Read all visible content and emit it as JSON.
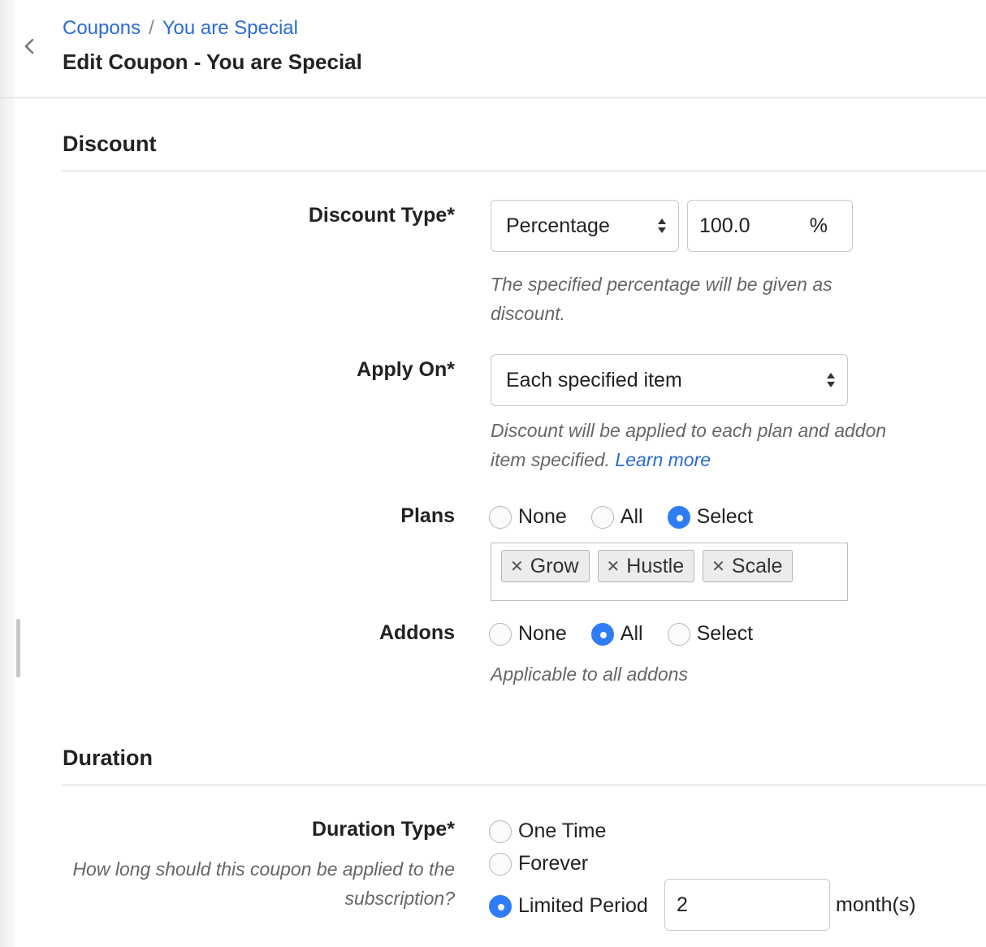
{
  "breadcrumb": {
    "parent": "Coupons",
    "separator": "/",
    "current": "You are Special"
  },
  "page_title": "Edit Coupon - You are Special",
  "discount": {
    "section_title": "Discount",
    "discount_type": {
      "label": "Discount Type*",
      "selected": "Percentage",
      "value": "100.0",
      "suffix": "%",
      "help": "The specified percentage will be given as discount."
    },
    "apply_on": {
      "label": "Apply On*",
      "selected": "Each specified item",
      "help": "Discount will be applied to each plan and addon item specified.",
      "help_link": "Learn more"
    },
    "plans": {
      "label": "Plans",
      "options": [
        "None",
        "All",
        "Select"
      ],
      "selected": "Select",
      "tags": [
        "Grow",
        "Hustle",
        "Scale"
      ]
    },
    "addons": {
      "label": "Addons",
      "options": [
        "None",
        "All",
        "Select"
      ],
      "selected": "All",
      "help": "Applicable to all addons"
    }
  },
  "duration": {
    "section_title": "Duration",
    "label": "Duration Type*",
    "help": "How long should this coupon be applied to the subscription?",
    "options": [
      "One Time",
      "Forever",
      "Limited Period"
    ],
    "selected": "Limited Period",
    "period_value": "2",
    "period_unit": "month(s)"
  },
  "colors": {
    "link": "#2a6bd3",
    "radio_active": "#2f7cf6"
  }
}
